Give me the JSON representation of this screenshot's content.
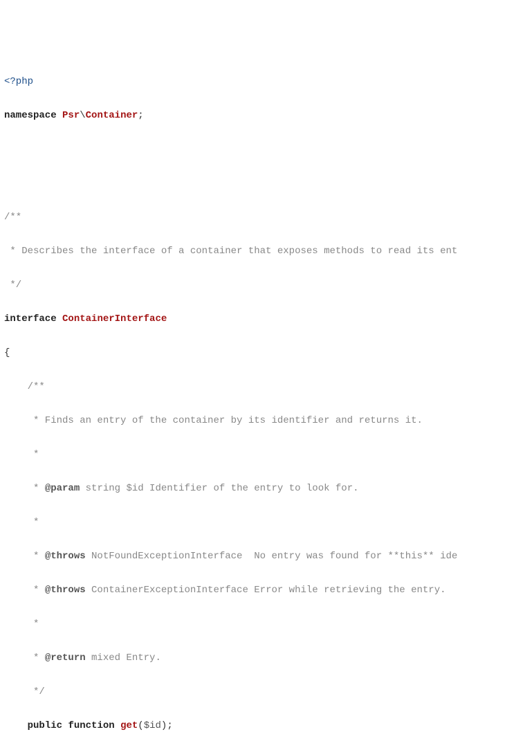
{
  "code": {
    "phpOpen": "<?php",
    "nsKeyword": "namespace",
    "ns1": "Psr",
    "nsSep": "\\",
    "ns2": "Container",
    "semicolon": ";",
    "docOpen": "/**",
    "docDesc": " * Describes the interface of a container that exposes methods to read its ent",
    "docClose": " */",
    "ifaceKeyword": "interface",
    "ifaceName": "ContainerInterface",
    "braceOpen": "{",
    "mDocOpen": "    /**",
    "mDocLine1": "     * Finds an entry of the container by its identifier and returns it.",
    "mDocStar": "     *",
    "mDocParamPre": "     * ",
    "tagParam": "@param",
    "mDocParamRest": " string $id Identifier of the entry to look for.",
    "tagThrows": "@throws",
    "mDocThrows1Rest": " NotFoundExceptionInterface  No entry was found for **this** ide",
    "mDocThrows2Rest": " ContainerExceptionInterface Error while retrieving the entry.",
    "tagReturn": "@return",
    "mDocReturnRest": " mixed Entry.",
    "mDocClose": "     */",
    "indent": "    ",
    "visPublic": "public",
    "kwFunction": "function",
    "fnName": "get",
    "lparen": "(",
    "paramVar": "$id",
    "rparen": ")",
    "space": " "
  }
}
